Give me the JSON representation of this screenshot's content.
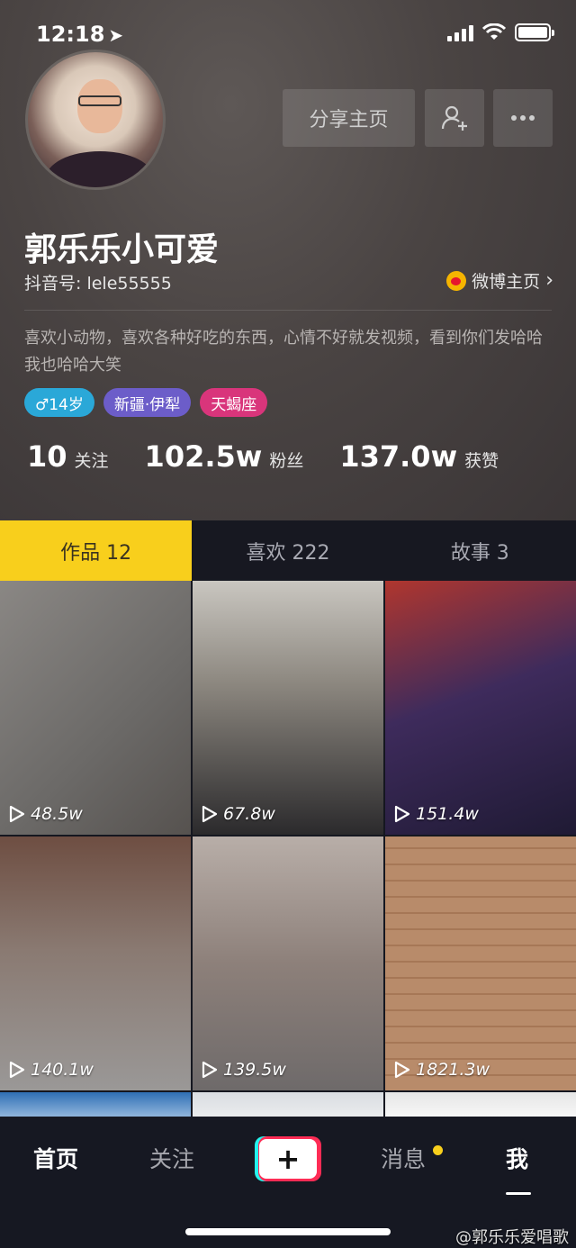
{
  "status_bar": {
    "time": "12:18",
    "location_glyph": "➤"
  },
  "profile": {
    "share_button": "分享主页",
    "nickname": "郭乐乐小可爱",
    "douyin_id": "抖音号: lele55555",
    "weibo_link": "微博主页",
    "weibo_chevron": "›",
    "bio": "喜欢小动物，喜欢各种好吃的东西，心情不好就发视频，看到你们发哈哈我也哈哈大笑",
    "tags": {
      "gender_age": "♂14岁",
      "location": "新疆·伊犁",
      "zodiac": "天蝎座"
    },
    "stats": {
      "following_num": "10",
      "following_label": "关注",
      "fans_num": "102.5w",
      "fans_label": "粉丝",
      "likes_num": "137.0w",
      "likes_label": "获赞"
    }
  },
  "tabs": [
    {
      "label": "作品 12"
    },
    {
      "label": "喜欢 222"
    },
    {
      "label": "故事 3"
    }
  ],
  "videos": [
    {
      "plays": "48.5w"
    },
    {
      "plays": "67.8w"
    },
    {
      "plays": "151.4w"
    },
    {
      "plays": "140.1w"
    },
    {
      "plays": "139.5w"
    },
    {
      "plays": "1821.3w"
    }
  ],
  "bottom_nav": {
    "home": "首页",
    "follow": "关注",
    "plus": "+",
    "messages": "消息",
    "me": "我"
  },
  "watermark": "@郭乐乐爱唱歌",
  "colors": {
    "tab_active": "#f8cf1c",
    "tag_gender": "#2aa8d8",
    "tag_location": "#6c5dc9",
    "tag_zodiac": "#d9357b",
    "plus_cyan": "#25f4ee",
    "plus_red": "#fe2c55"
  },
  "icons": [
    "location-arrow-icon",
    "signal-icon",
    "wifi-icon",
    "battery-icon",
    "add-friend-icon",
    "more-icon",
    "weibo-icon",
    "play-icon"
  ]
}
